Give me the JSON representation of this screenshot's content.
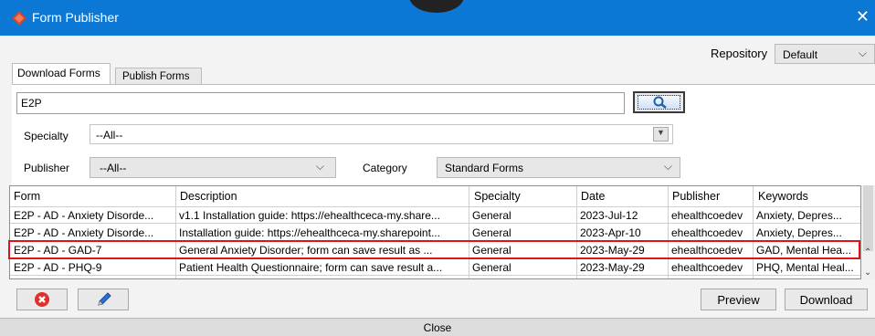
{
  "window": {
    "title": "Form Publisher",
    "close_glyph": "✕",
    "brand_color": "#0a78d4"
  },
  "repository": {
    "label": "Repository",
    "value": "Default"
  },
  "tabs": [
    {
      "label": "Download Forms"
    },
    {
      "label": "Publish Forms"
    }
  ],
  "search": {
    "value": "E2P"
  },
  "filters": {
    "specialty_label": "Specialty",
    "specialty_value": "--All--",
    "publisher_label": "Publisher",
    "publisher_value": "--All--",
    "category_label": "Category",
    "category_value": "Standard Forms"
  },
  "table": {
    "headers": [
      "Form",
      "Description",
      "Specialty",
      "Date",
      "Publisher",
      "Keywords"
    ],
    "rows": [
      [
        "E2P - AD - Anxiety Disorde...",
        "v1.1 Installation guide: https://ehealthceca-my.share...",
        "General",
        "2023-Jul-12",
        "ehealthcoedev",
        "Anxiety, Depres..."
      ],
      [
        "E2P - AD - Anxiety Disorde...",
        "Installation guide: https://ehealthceca-my.sharepoint...",
        "General",
        "2023-Apr-10",
        "ehealthcoedev",
        "Anxiety, Depres..."
      ],
      [
        "E2P - AD - GAD-7",
        "General Anxiety Disorder; form can save result as ...",
        "General",
        "2023-May-29",
        "ehealthcoedev",
        "GAD, Mental Hea..."
      ],
      [
        "E2P - AD - PHQ-9",
        "Patient Health Questionnaire; form can save result a...",
        "General",
        "2023-May-29",
        "ehealthcoedev",
        "PHQ, Mental Heal..."
      ]
    ],
    "highlight_color": "#e2121b"
  },
  "buttons": {
    "preview": "Preview",
    "download": "Download",
    "close": "Close"
  },
  "icons": {
    "delete": "delete-icon",
    "edit": "pencil-icon",
    "search": "search-icon"
  }
}
